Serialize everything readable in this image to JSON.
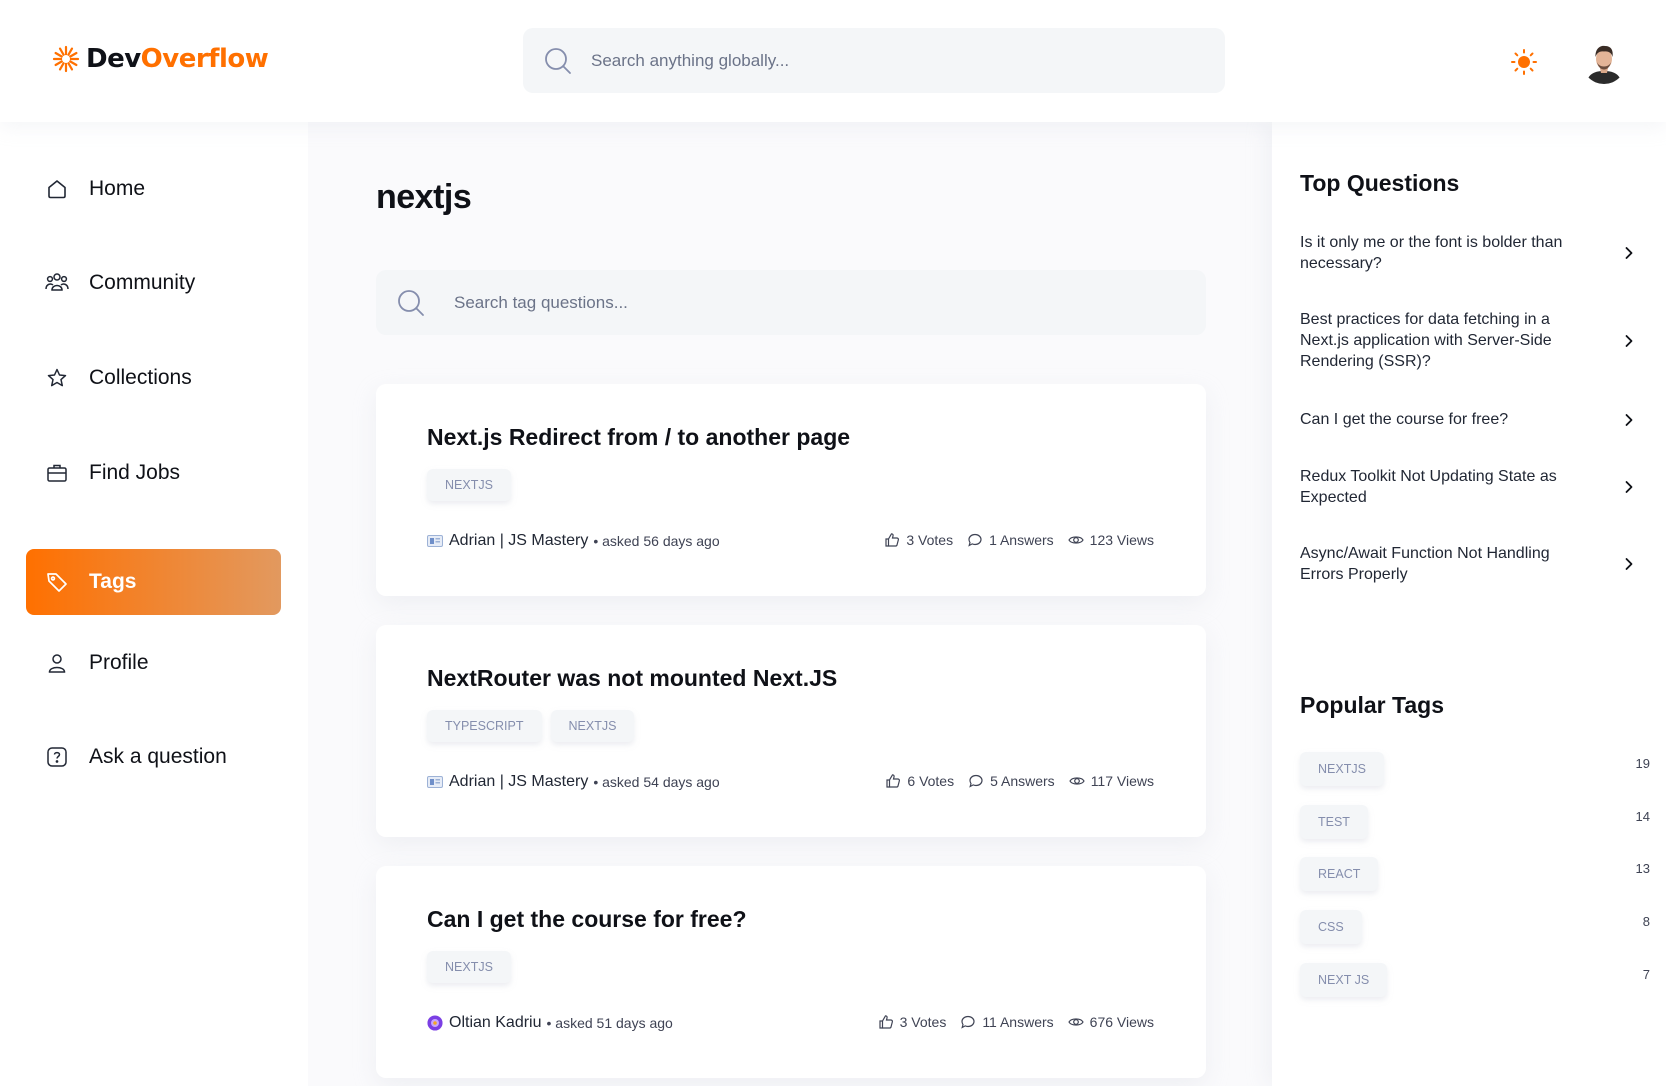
{
  "navbar": {
    "logo": {
      "dev": "Dev",
      "overflow": "Overflow"
    },
    "search_placeholder": "Search anything globally...",
    "icons": {
      "search": "search-icon",
      "theme": "sun-icon",
      "avatar": "user-avatar"
    },
    "accent_color": "#ff7000"
  },
  "sidebar": {
    "items": [
      {
        "label": "Home",
        "icon": "home-icon",
        "active": false
      },
      {
        "label": "Community",
        "icon": "users-icon",
        "active": false
      },
      {
        "label": "Collections",
        "icon": "star-icon",
        "active": false
      },
      {
        "label": "Find Jobs",
        "icon": "briefcase-icon",
        "active": false
      },
      {
        "label": "Tags",
        "icon": "tag-icon",
        "active": true
      },
      {
        "label": "Profile",
        "icon": "user-icon",
        "active": false
      },
      {
        "label": "Ask a question",
        "icon": "question-icon",
        "active": false
      }
    ]
  },
  "main": {
    "title": "nextjs",
    "search_placeholder": "Search tag questions...",
    "questions": [
      {
        "title": "Next.js Redirect from / to another page",
        "tags": [
          "NEXTJS"
        ],
        "author": "Adrian | JS Mastery",
        "asked": "• asked 56 days ago",
        "votes": "3 Votes",
        "answers": "1 Answers",
        "views": "123 Views"
      },
      {
        "title": "NextRouter was not mounted Next.JS",
        "tags": [
          "TYPESCRIPT",
          "NEXTJS"
        ],
        "author": "Adrian | JS Mastery",
        "asked": "• asked 54 days ago",
        "votes": "6 Votes",
        "answers": "5 Answers",
        "views": "117 Views"
      },
      {
        "title": "Can I get the course for free?",
        "tags": [
          "NEXTJS"
        ],
        "author": "Oltian Kadriu",
        "asked": "• asked 51 days ago",
        "votes": "3 Votes",
        "answers": "11 Answers",
        "views": "676 Views"
      }
    ]
  },
  "right_sidebar": {
    "top_questions_title": "Top Questions",
    "top_questions": [
      "Is it only me or the font is bolder than necessary?",
      "Best practices for data fetching in a Next.js application with Server-Side Rendering (SSR)?",
      "Can I get the course for free?",
      "Redux Toolkit Not Updating State as Expected",
      "Async/Await Function Not Handling Errors Properly"
    ],
    "popular_tags_title": "Popular Tags",
    "popular_tags": [
      {
        "name": "NEXTJS",
        "count": "19"
      },
      {
        "name": "TEST",
        "count": "14"
      },
      {
        "name": "REACT",
        "count": "13"
      },
      {
        "name": "CSS",
        "count": "8"
      },
      {
        "name": "NEXT JS",
        "count": "7"
      }
    ]
  }
}
